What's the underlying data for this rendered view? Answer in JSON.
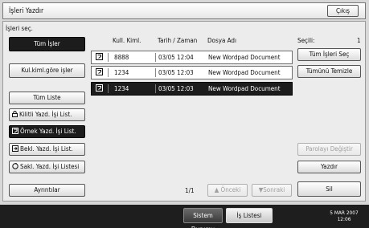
{
  "header": {
    "title": "İşleri Yazdır",
    "exit_label": "Çıkış"
  },
  "main": {
    "select_jobs_label": "İşleri seç.",
    "selected_label": "Seçili:",
    "selected_count": "1"
  },
  "left_buttons": {
    "all_jobs": "Tüm İşler",
    "by_user_id": "Kul.kiml.göre işler",
    "full_list": "Tüm Liste",
    "locked_list": "Kilitli Yazd. İşi List.",
    "sample_list": "Örnek Yazd. İşi List.",
    "hold_list": "Bekl. Yazd. İşi List.",
    "stored_list": "Sakl. Yazd. İşi Listesi",
    "details": "Ayrıntılar"
  },
  "table": {
    "columns": [
      "Kull. Kiml.",
      "Tarih / Zaman",
      "Dosya Adı"
    ],
    "rows": [
      {
        "user_id": "8888",
        "datetime": "03/05 12:04",
        "file": "New Wordpad Document",
        "selected": false
      },
      {
        "user_id": "1234",
        "datetime": "03/05 12:03",
        "file": "New Wordpad Document",
        "selected": false
      },
      {
        "user_id": "1234",
        "datetime": "03/05 12:03",
        "file": "New Wordpad Document",
        "selected": true
      }
    ]
  },
  "pagination": {
    "page": "1/1",
    "prev_label": "Önceki",
    "next_label": "Sonraki"
  },
  "right_buttons": {
    "select_all": "Tüm İşleri Seç",
    "clear_all": "Tümünü Temizle",
    "change_password": "Parolayı Değiştir",
    "print": "Yazdır",
    "delete": "Sil"
  },
  "bottom": {
    "system_status": "Sistem Durumu",
    "job_list": "İş Listesi",
    "date": "5 MAR 2007",
    "time": "12:06"
  },
  "icons": {
    "job": "sample-print-job-icon",
    "lock": "lock-icon",
    "sample": "sample-print-icon",
    "hold": "hold-print-icon",
    "stored": "stored-print-icon"
  }
}
